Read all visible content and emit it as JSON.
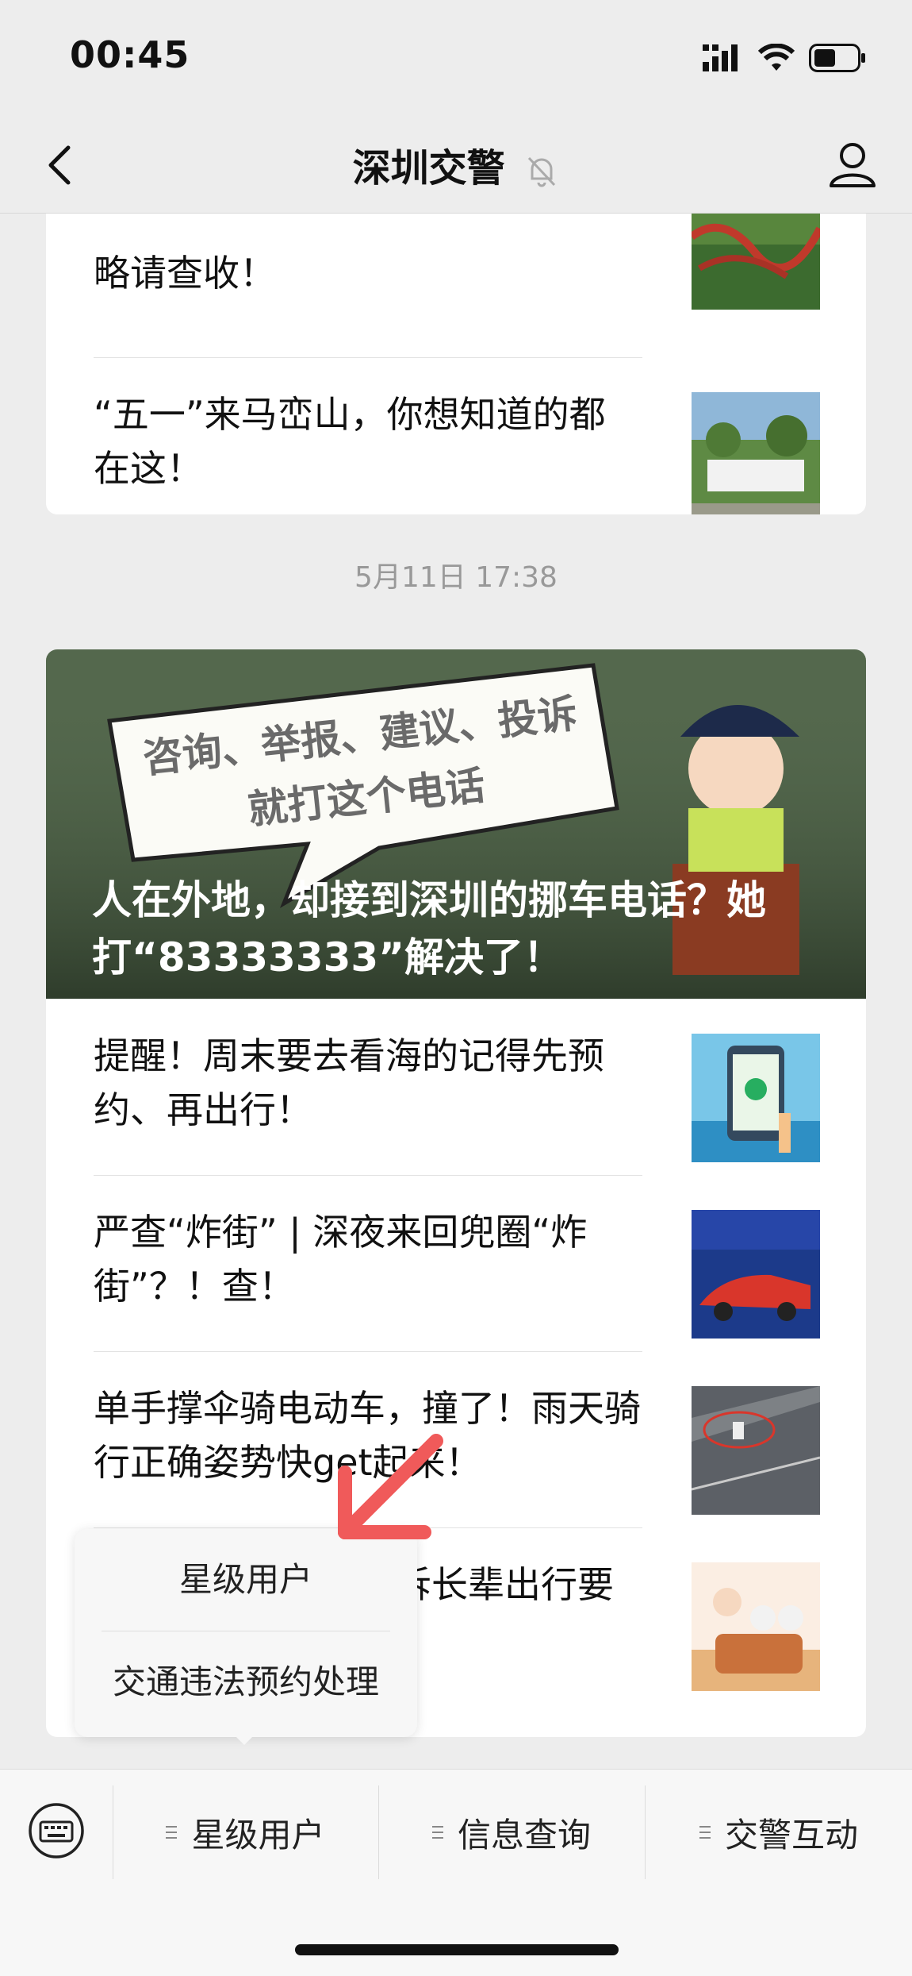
{
  "status": {
    "time": "00:45"
  },
  "nav": {
    "title": "深圳交警"
  },
  "feed": {
    "card1": {
      "items": [
        {
          "title": "略请查收！"
        },
        {
          "title": "“五一”来马峦山，你想知道的都在这！"
        }
      ]
    },
    "timestamp": "5月11日 17:38",
    "card2": {
      "hero_title": "人在外地，却接到深圳的挪车电话？她打“83333333”解决了！",
      "hero_image_text": "咨询、举报、建议、投诉 就打这个电话",
      "items": [
        {
          "title": "提醒！周末要去看海的记得先预约、再出行！"
        },
        {
          "title": "严查“炸街” | 深夜来回兜圈“炸街”？！查！"
        },
        {
          "title": "单手撑伞骑电动车，撞了！雨天骑行正确姿势快get起来！"
        },
        {
          "title": "诉长辈出行要"
        }
      ]
    }
  },
  "popup": {
    "items": [
      {
        "label": "星级用户"
      },
      {
        "label": "交通违法预约处理"
      }
    ]
  },
  "menu": {
    "items": [
      {
        "label": "星级用户"
      },
      {
        "label": "信息查询"
      },
      {
        "label": "交警互动"
      }
    ]
  },
  "colors": {
    "background": "#ededed",
    "card": "#ffffff",
    "annotation_arrow": "#f05a5a"
  }
}
